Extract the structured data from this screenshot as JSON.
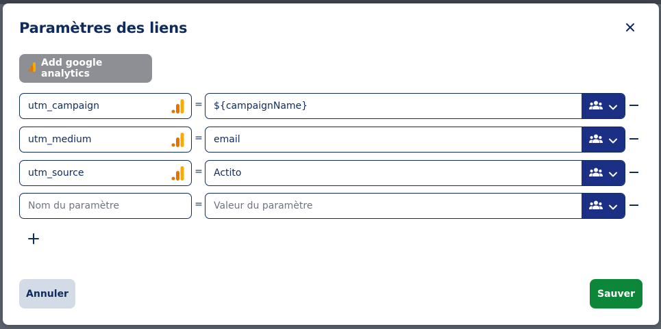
{
  "dialog": {
    "title": "Paramètres des liens",
    "add_ga_label": "Add google analytics",
    "cancel_label": "Annuler",
    "save_label": "Sauver"
  },
  "params": [
    {
      "name": "utm_campaign",
      "value": "${campaignName}",
      "google_analytics": true
    },
    {
      "name": "utm_medium",
      "value": "email",
      "google_analytics": true
    },
    {
      "name": "utm_source",
      "value": "Actito",
      "google_analytics": true
    },
    {
      "name": "",
      "name_placeholder": "Nom du paramètre",
      "value": "",
      "value_placeholder": "Valeur du paramètre",
      "google_analytics": false
    }
  ],
  "equals_sign": "=",
  "icons": {
    "close": "close-icon",
    "google_analytics": "google-analytics-icon",
    "personalization": "people-icon",
    "dropdown": "chevron-down-icon",
    "remove": "minus-icon",
    "add": "plus-icon"
  },
  "colors": {
    "primary": "#0f2a5c",
    "personalization_button": "#1b2f85",
    "save": "#0c8638",
    "cancel": "#d3dbe6",
    "ga_button": "#8d8f94",
    "ga_orange": "#f9ab00",
    "ga_dark_orange": "#e37400"
  }
}
